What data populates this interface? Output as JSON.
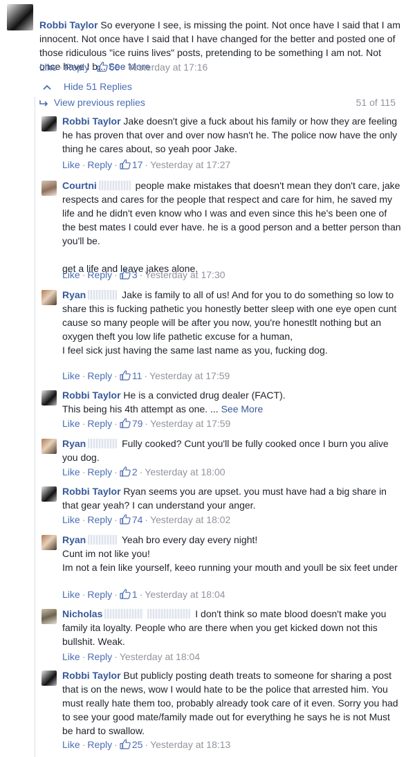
{
  "top_comment": {
    "author": "Robbi Taylor",
    "text": " So everyone I see, is missing the point. Not once have I said that I am innocent. Not once have I said that I have changed for the better and posted one of those ridiculous \"ice ruins lives\" posts, pretending to be something I am not. Not once have I b... ",
    "see_more": "See More",
    "like": "Like",
    "reply": "Reply",
    "likes": "60",
    "time": "Yesterday at 17:16"
  },
  "thread": {
    "hide_label": "Hide 51 Replies",
    "prev_label": "View previous replies",
    "count": "51 of 115"
  },
  "replies": [
    {
      "author": "Robbi Taylor",
      "text": " Jake doesn't give a fuck about his family or how they are feeling he has proven that over and over now hasn't he. The police now have the only thing he cares about, so yeah poor Jake.",
      "like": "Like",
      "reply": "Reply",
      "likes": "17",
      "time": "Yesterday at 17:27"
    },
    {
      "author": "Courtni",
      "text": " people make mistakes that doesn't mean they don't care, jake respects and cares for the people that respect and care for him, he saved my life and he didn't even know who I was and even since this he's been one of the best mates I could ever have. he is a good person and a better person than you'll be.\n\nget a life and leave jakes alone.",
      "like": "Like",
      "reply": "Reply",
      "likes": "3",
      "time": "Yesterday at 17:30"
    },
    {
      "author": "Ryan",
      "text": " Jake is family to all of us! And for you to do something so low to share this is fucking pathetic you honestly better sleep with one eye open cunt cause so many people will be after you now, you're honestlt nothing but an oxygen theft you low life pathetic excuse for a human,\nI feel sick just having the same last name as you, fucking dog.",
      "like": "Like",
      "reply": "Reply",
      "likes": "11",
      "time": "Yesterday at 17:59"
    },
    {
      "author": "Robbi Taylor",
      "text": " He is a convicted drug dealer (FACT).\nThis being his 4th attempt as one. ... ",
      "see_more": "See More",
      "like": "Like",
      "reply": "Reply",
      "likes": "79",
      "time": "Yesterday at 17:59"
    },
    {
      "author": "Ryan",
      "text": " Fully cooked? Cunt you'll be fully cooked once I burn you alive you dog.",
      "like": "Like",
      "reply": "Reply",
      "likes": "2",
      "time": "Yesterday at 18:00"
    },
    {
      "author": "Robbi Taylor",
      "text": " Ryan seems you are upset. you must have had a big share in that gear yeah? I can understand your anger.",
      "like": "Like",
      "reply": "Reply",
      "likes": "74",
      "time": "Yesterday at 18:02"
    },
    {
      "author": "Ryan",
      "text": " Yeah bro every day every night!\nCunt im not like you!\nIm not a fein like yourself, keeo running your mouth and youll be six feet under",
      "like": "Like",
      "reply": "Reply",
      "likes": "1",
      "time": "Yesterday at 18:04"
    },
    {
      "author": "Nicholas",
      "text": " I don't think so mate blood doesn't make you family ita loyalty. People who are there when you get kicked down not this bullshit. Weak.",
      "like": "Like",
      "reply": "Reply",
      "likes": "",
      "time": "Yesterday at 18:04"
    },
    {
      "author": "Robbi Taylor",
      "text": " But publicly posting death treats to someone for sharing a post that is on the news, wow I would hate to be the police that arrested him. You must really hate them too, probably already took care of it even. Sorry you had to see your good mate/family made out for everything he says he is not Must be hard to swallow.",
      "like": "Like",
      "reply": "Reply",
      "likes": "25",
      "time": "Yesterday at 18:13"
    }
  ],
  "colors": {
    "link": "#365899",
    "action": "#4b6db3",
    "meta": "#90949c",
    "text": "#1d2129"
  }
}
